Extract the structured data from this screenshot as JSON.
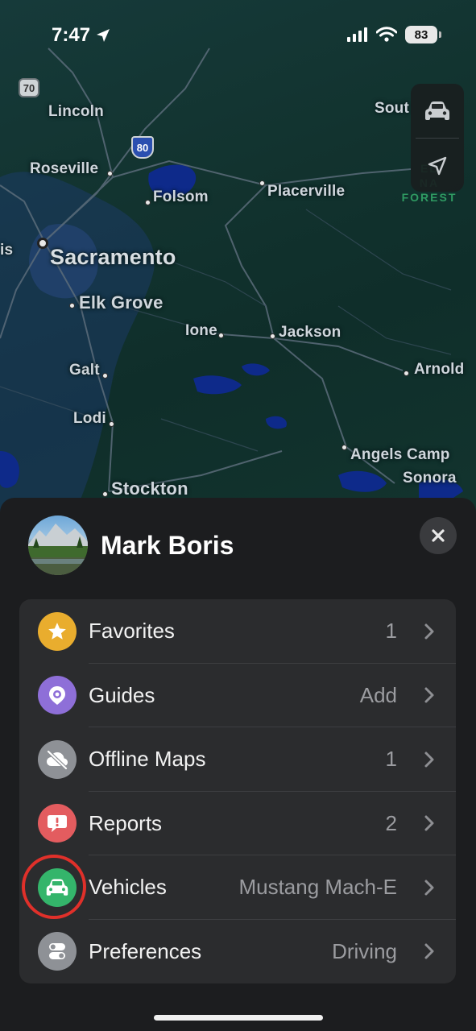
{
  "status_bar": {
    "time": "7:47",
    "battery": "83"
  },
  "map": {
    "cities": [
      {
        "name": "Lincoln",
        "size": "sm"
      },
      {
        "name": "Roseville",
        "size": "sm"
      },
      {
        "name": "Folsom",
        "size": "sm"
      },
      {
        "name": "Placerville",
        "size": "sm"
      },
      {
        "name": "Sacramento",
        "size": "big"
      },
      {
        "name": "Elk Grove",
        "size": "mid"
      },
      {
        "name": "Ione",
        "size": "sm"
      },
      {
        "name": "Jackson",
        "size": "sm"
      },
      {
        "name": "Galt",
        "size": "sm"
      },
      {
        "name": "Arnold",
        "size": "sm"
      },
      {
        "name": "Lodi",
        "size": "sm"
      },
      {
        "name": "Angels Camp",
        "size": "sm"
      },
      {
        "name": "Sonora",
        "size": "sm"
      },
      {
        "name": "Stockton",
        "size": "mid"
      },
      {
        "name": "Sout",
        "size": "sm"
      },
      {
        "name": "is",
        "size": "sm"
      }
    ],
    "forest_label": "EL\nNA\nFOREST",
    "route_shields": {
      "state": "70",
      "interstate": "80"
    }
  },
  "profile": {
    "name": "Mark Boris"
  },
  "menu": [
    {
      "label": "Favorites",
      "value": "1",
      "icon": "star-icon",
      "color": "#e9ad2e"
    },
    {
      "label": "Guides",
      "value": "Add",
      "icon": "guide-pin-icon",
      "color": "#8e6fd8"
    },
    {
      "label": "Offline Maps",
      "value": "1",
      "icon": "cloud-slash-icon",
      "color": "#8e9196"
    },
    {
      "label": "Reports",
      "value": "2",
      "icon": "exclamation-bubble-icon",
      "color": "#e35c5f"
    },
    {
      "label": "Vehicles",
      "value": "Mustang Mach-E",
      "icon": "car-icon",
      "color": "#34b56b"
    },
    {
      "label": "Preferences",
      "value": "Driving",
      "icon": "toggles-icon",
      "color": "#8e9196"
    }
  ],
  "annotation": {
    "highlight_color": "#e0302a",
    "highlighted_item": "Vehicles"
  }
}
